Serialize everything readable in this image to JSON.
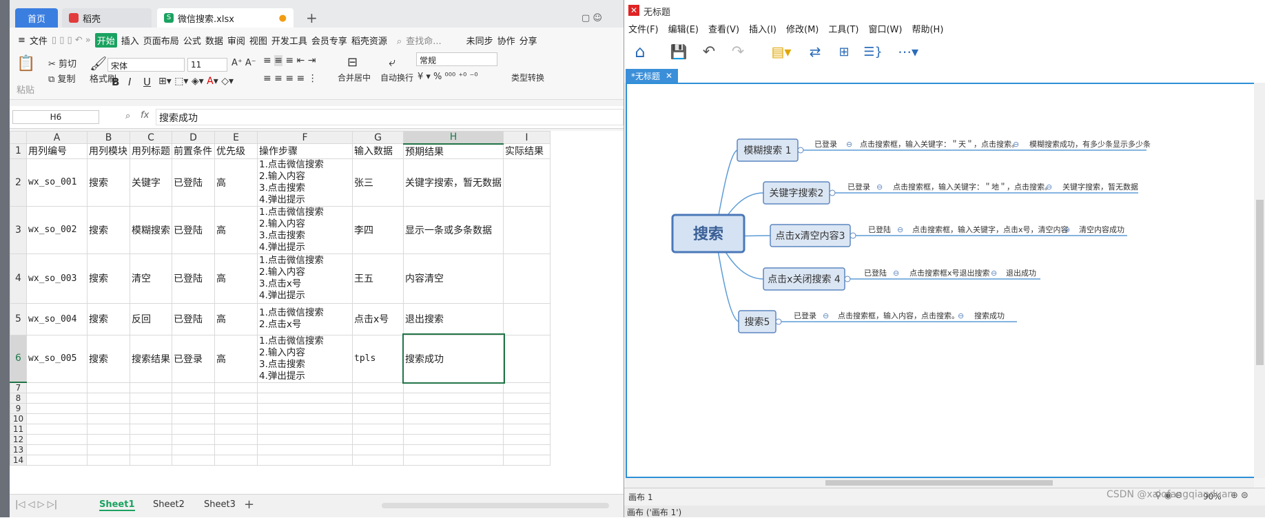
{
  "sheet_app": {
    "tabs": {
      "home": "首页",
      "docer": "稻壳",
      "file": "微信搜索.xlsx"
    },
    "menu": [
      "文件",
      "开始",
      "插入",
      "页面布局",
      "公式",
      "数据",
      "审阅",
      "视图",
      "开发工具",
      "会员专享",
      "稻壳资源"
    ],
    "search_placeholder": "查找命...",
    "right_menu": [
      "未同步",
      "协作",
      "分享"
    ],
    "ribbon": {
      "paste": "粘贴",
      "cut": "剪切",
      "copy": "复制",
      "format_painter": "格式刷",
      "font_name": "宋体",
      "font_size": "11",
      "merge": "合并居中",
      "wrap": "自动换行",
      "number_format": "常规",
      "type_convert": "类型转换",
      "bold": "B",
      "italic": "I",
      "underline": "U"
    },
    "formula": {
      "cell_ref": "H6",
      "fx": "fx",
      "content": "搜索成功"
    },
    "columns": [
      "A",
      "B",
      "C",
      "D",
      "E",
      "F",
      "G",
      "H",
      "I"
    ],
    "header_row": [
      "用列编号",
      "用列模块",
      "用列标题",
      "前置条件",
      "优先级",
      "操作步骤",
      "输入数据",
      "预期结果",
      "实际结果"
    ],
    "rows": [
      {
        "num": "2",
        "a": "wx_so_001",
        "b": "搜索",
        "c": "关键字",
        "d": "已登陆",
        "e": "高",
        "f": [
          "1.点击微信搜索",
          "2.输入内容",
          "3.点击搜索",
          "4.弹出提示"
        ],
        "g": "张三",
        "h": "关键字搜索，暂无数据"
      },
      {
        "num": "3",
        "a": "wx_so_002",
        "b": "搜索",
        "c": "模糊搜索",
        "d": "已登陆",
        "e": "高",
        "f": [
          "1.点击微信搜索",
          "2.输入内容",
          "3.点击搜索",
          "4.弹出提示"
        ],
        "g": "李四",
        "h": "显示一条或多条数据"
      },
      {
        "num": "4",
        "a": "wx_so_003",
        "b": "搜索",
        "c": "清空",
        "d": "已登陆",
        "e": "高",
        "f": [
          "1.点击微信搜索",
          "2.输入内容",
          "3.点击x号",
          "4.弹出提示"
        ],
        "g": "王五",
        "h": "内容清空"
      },
      {
        "num": "5",
        "a": "wx_so_004",
        "b": "搜索",
        "c": "反回",
        "d": "已登陆",
        "e": "高",
        "f": [
          "1.点击微信搜索",
          "2.点击x号"
        ],
        "g": "点击x号",
        "h": "退出搜索"
      },
      {
        "num": "6",
        "a": "wx_so_005",
        "b": "搜索",
        "c": "搜索结果",
        "d": "已登录",
        "e": "高",
        "f": [
          "1.点击微信搜索",
          "2.输入内容",
          "3.点击搜索",
          "4.弹出提示"
        ],
        "g": "tpls",
        "h": "搜索成功"
      }
    ],
    "empty_rows": [
      "7",
      "8",
      "9",
      "10",
      "11",
      "12",
      "13",
      "14"
    ],
    "sheet_tabs": [
      "Sheet1",
      "Sheet2",
      "Sheet3"
    ]
  },
  "mindmap_app": {
    "title": "无标题",
    "menu": [
      "文件(F)",
      "编辑(E)",
      "查看(V)",
      "插入(I)",
      "修改(M)",
      "工具(T)",
      "窗口(W)",
      "帮助(H)"
    ],
    "doc_tab": "*无标题",
    "root": "搜索",
    "branches": [
      {
        "label": "模糊搜索 1",
        "pre": "已登录",
        "step": "点击搜索框，输入关键字：＂天＂，点击搜索。",
        "result": "模糊搜索成功，有多少条显示多少条"
      },
      {
        "label": "关键字搜索2",
        "pre": "已登录",
        "step": "点击搜索框，输入关键字：＂地＂，点击搜索。",
        "result": "关键字搜索，暂无数据"
      },
      {
        "label": "点击x清空内容3",
        "pre": "已登陆",
        "step": "点击搜索框，输入关键字，点击x号，清空内容",
        "result": "清空内容成功"
      },
      {
        "label": "点击x关闭搜索 4",
        "pre": "已登陆",
        "step": "点击搜索框x号退出搜索",
        "result": "退出成功"
      },
      {
        "label": "搜索5",
        "pre": "已登录",
        "step": "点击搜索框，输入内容，点击搜索。",
        "result": "搜索成功"
      }
    ],
    "canvas_tab": "画布 1",
    "zoom": "90%",
    "footer": "画布 ('画布 1')",
    "watermark": "CSDN @xaiofangqianduan"
  },
  "colors": {
    "accent_green": "#217346",
    "wps_blue": "#3a7ee0",
    "node_fill": "#dbe6f4",
    "node_border": "#5b86c0",
    "line": "#5b9bd5"
  }
}
